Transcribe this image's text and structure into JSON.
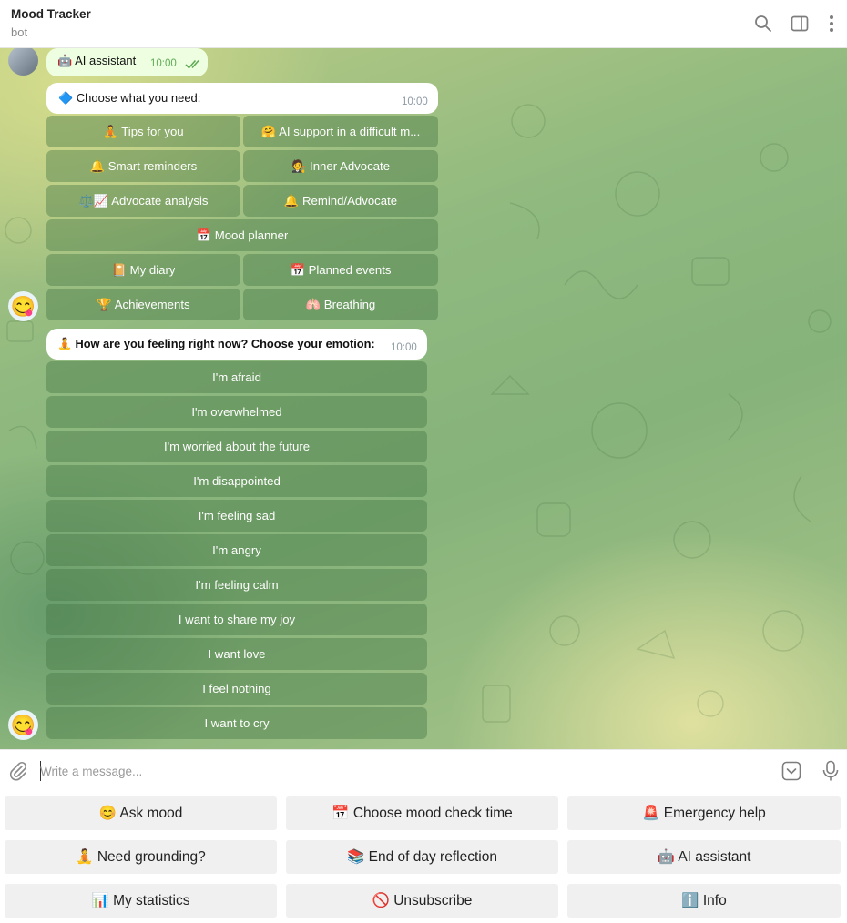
{
  "header": {
    "title": "Mood Tracker",
    "subtitle": "bot"
  },
  "messages": {
    "ai_assistant": {
      "text": "🤖 AI assistant",
      "time": "10:00"
    },
    "choose_need": {
      "text": "🔷 Choose what you need:",
      "time": "10:00",
      "buttons": [
        "🧘 Tips for you",
        "🤗 AI support in a difficult m...",
        "🔔 Smart reminders",
        "🧑‍⚖️ Inner Advocate",
        "⚖️📈 Advocate analysis",
        "🔔 Remind/Advocate",
        "📅 Mood planner",
        "📔 My diary",
        "📅 Planned events",
        "🏆 Achievements",
        "🫁 Breathing"
      ]
    },
    "feeling": {
      "text": "🧘 How are you feeling right now? Choose your emotion:",
      "time": "10:00",
      "buttons": [
        "I'm afraid",
        "I'm overwhelmed",
        "I'm worried about the future",
        "I'm disappointed",
        "I'm feeling sad",
        "I'm angry",
        "I'm feeling calm",
        "I want to share my joy",
        "I want love",
        "I feel nothing",
        "I want to cry"
      ]
    }
  },
  "bot_avatar_emoji": "😋",
  "composer": {
    "placeholder": "Write a message..."
  },
  "reply_keyboard": [
    "😊 Ask mood",
    "📅 Choose mood check time",
    "🚨 Emergency help",
    "🧘 Need grounding?",
    "📚 End of day reflection",
    "🤖 AI assistant",
    "📊 My statistics",
    "🚫 Unsubscribe",
    "ℹ️ Info"
  ],
  "colors": {
    "keyboard_button_bg": "rgba(70,118,70,0.42)",
    "outgoing_bubble": "#eefee0",
    "read_check": "#5eaa55",
    "reply_button_bg": "#f0f0f0"
  }
}
